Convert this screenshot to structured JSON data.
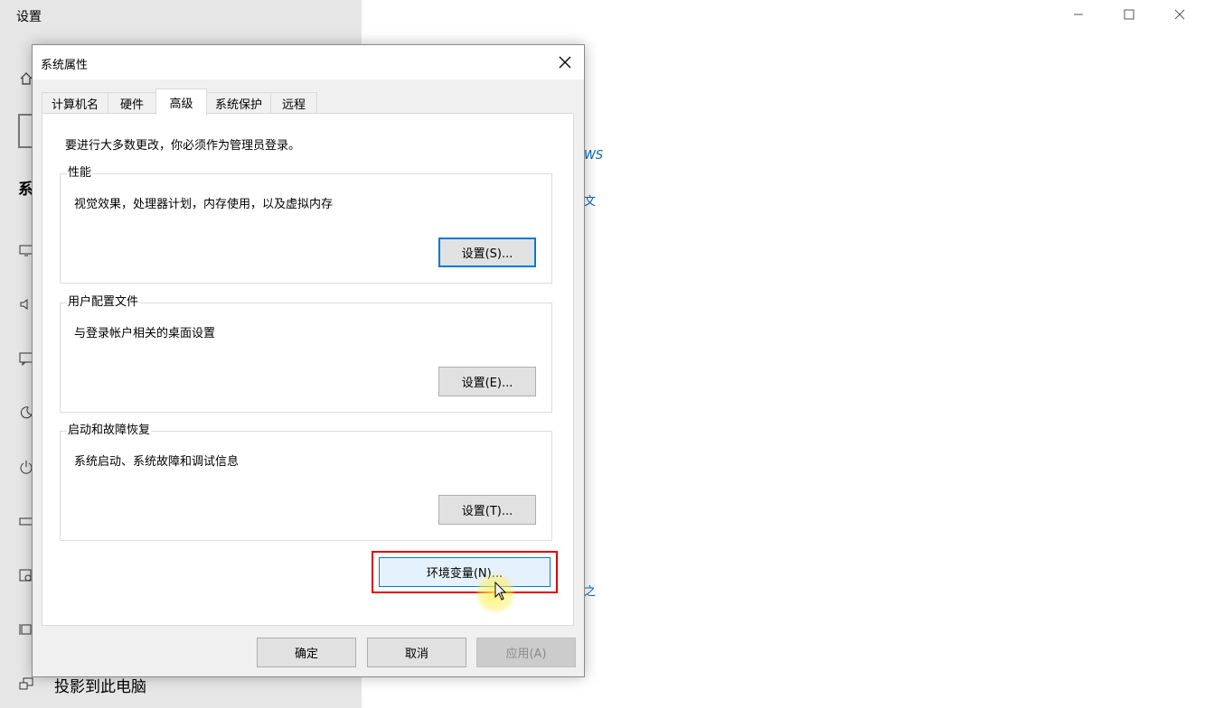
{
  "settings": {
    "title": "设置",
    "section_heading": "系",
    "bottom_item": "投影到此电脑",
    "peek_texts": [
      "WS",
      "文",
      "之"
    ]
  },
  "dialog": {
    "title": "系统属性",
    "tabs": [
      {
        "label": "计算机名"
      },
      {
        "label": "硬件"
      },
      {
        "label": "高级"
      },
      {
        "label": "系统保护"
      },
      {
        "label": "远程"
      }
    ],
    "admin_note": "要进行大多数更改，你必须作为管理员登录。",
    "groups": {
      "performance": {
        "label": "性能",
        "desc": "视觉效果，处理器计划，内存使用，以及虚拟内存",
        "button": "设置(S)..."
      },
      "profile": {
        "label": "用户配置文件",
        "desc": "与登录帐户相关的桌面设置",
        "button": "设置(E)..."
      },
      "startup": {
        "label": "启动和故障恢复",
        "desc": "系统启动、系统故障和调试信息",
        "button": "设置(T)..."
      }
    },
    "env_button": "环境变量(N)...",
    "footer": {
      "ok": "确定",
      "cancel": "取消",
      "apply": "应用(A)"
    }
  }
}
